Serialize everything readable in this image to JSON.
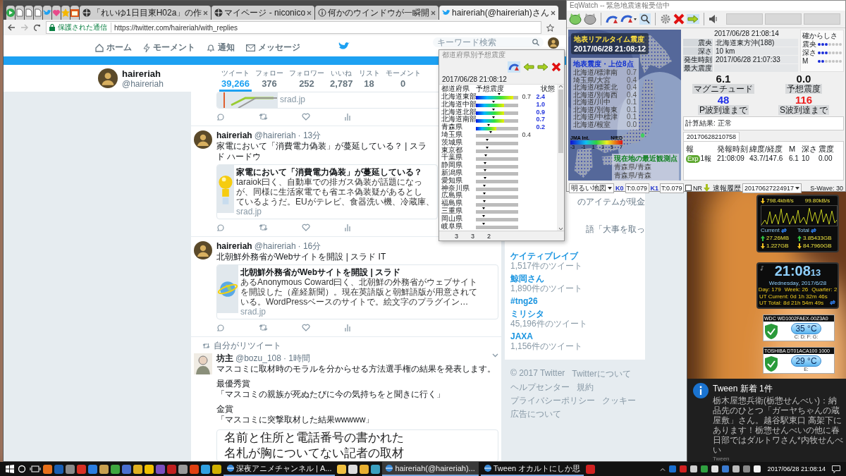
{
  "browser": {
    "pinned_tabs": [
      {
        "kind": "feed",
        "selected": false
      },
      {
        "kind": "page",
        "selected": false
      },
      {
        "kind": "page",
        "selected": false
      },
      {
        "kind": "page",
        "selected": false
      },
      {
        "kind": "bird",
        "selected": false
      },
      {
        "kind": "heart",
        "selected": false
      },
      {
        "kind": "star",
        "selected": false
      },
      {
        "kind": "calendar",
        "selected": false
      }
    ],
    "tabs": [
      {
        "kind": "globe",
        "title": "「れいゆ1日目東H02a」の作",
        "selected": false
      },
      {
        "kind": "globe",
        "title": "マイページ - niconico",
        "selected": false
      },
      {
        "kind": "info",
        "title": "何かのウインドウが一瞬開",
        "selected": false
      },
      {
        "kind": "bird",
        "title": "haireriah(@haireriah)さん",
        "selected": true
      }
    ],
    "secure_label": "保護された通信",
    "url": "https://twitter.com/haireriah/with_replies"
  },
  "twitter": {
    "nav": [
      {
        "kind": "home",
        "label": "ホーム",
        "selected": false
      },
      {
        "kind": "bolt",
        "label": "モーメント",
        "selected": false
      },
      {
        "kind": "bell",
        "label": "通知",
        "selected": false
      },
      {
        "kind": "mail",
        "label": "メッセージ",
        "selected": false
      }
    ],
    "search_placeholder": "キーワード検索",
    "profile": {
      "name": "haireriah",
      "handle": "@haireriah"
    },
    "stats": [
      {
        "label": "ツイート",
        "value": "39,266",
        "selected": true
      },
      {
        "label": "フォロー",
        "value": "376",
        "selected": false
      },
      {
        "label": "フォロワー",
        "value": "252",
        "selected": false
      },
      {
        "label": "いいね",
        "value": "2,787",
        "selected": false
      },
      {
        "label": "リスト",
        "value": "18",
        "selected": false
      },
      {
        "label": "モーメント",
        "value": "0",
        "selected": false
      }
    ],
    "tweets": [
      {
        "kind": "tail",
        "card": {
          "source": "srad.jp"
        }
      },
      {
        "kind": "link",
        "name": "haireriah",
        "handle": "@haireriah",
        "time": "· 13分",
        "text": "家電において「消費電力偽装」が蔓延している？ | スラド ハードウ",
        "card": {
          "title": "家電において「消費電力偽装」が蔓延している？",
          "lines": [
            "taraiok曰く、自動車での排ガス偽装が話題になっ",
            "が、同様に生活家電でも省エネ偽装疑があるとし",
            "ているようだ。EUがテレビ、食器洗い機、冷蔵庫、"
          ],
          "source": "srad.jp"
        }
      },
      {
        "kind": "link",
        "name": "haireriah",
        "handle": "@haireriah",
        "time": "· 16分",
        "text": "北朝鮮外務省がWebサイトを開設 | スラド IT",
        "card": {
          "title": "北朝鮮外務省がWebサイトを開設 | スラド",
          "lines": [
            "あるAnonymous Coward曰く、北朝鮮の外務省がウェブサイト",
            "を開設した（産経新聞）。現在英語版と朝鮮語版が用意されて",
            "いる。WordPressベースのサイトで。絵文字のプラグイン…"
          ],
          "source": "srad.jp"
        }
      },
      {
        "kind": "retweet",
        "retweeted_by": "自分がリツイート",
        "name": "坊主",
        "handle": "@bozu_108",
        "time": "· 1時間",
        "paragraphs": [
          [
            "マスコミに取材時のモラルを分からせる方法選手権の結果を発表します。"
          ],
          [
            "最優秀賞",
            "「マスコミの親族が死ぬたびに今の気持ちをと聞きに行く」"
          ],
          [
            "金賞",
            "「マスコミに突撃取材した結果wwwww」"
          ]
        ],
        "image_lines": [
          "名前と住所と電話番号の書かれた",
          "名札が胸についてない記者の取材"
        ]
      }
    ],
    "trend_fragments": [
      "のアイテムが現金",
      "語「大事を取っ"
    ],
    "trends": [
      {
        "name": "ケイティブレイブ",
        "count": "1,517件のツイート"
      },
      {
        "name": "鯨岡さん",
        "count": "1,890件のツイート"
      },
      {
        "name": "#tng26"
      },
      {
        "name": "ミリシタ",
        "count": "45,196件のツイート"
      },
      {
        "name": "JAXA",
        "count": "1,156件のツイート"
      }
    ],
    "footer": [
      "© 2017 Twitter",
      "Twitterについて",
      "ヘルプセンター",
      "規約",
      "プライバシーポリシー",
      "クッキー",
      "広告について"
    ]
  },
  "prefecture_popup": {
    "title": "都道府県別予想震度",
    "time": "2017/06/28 21:08:12",
    "columns": [
      "都道府県",
      "予想震度",
      "状態"
    ],
    "rows": [
      {
        "name": "北海道東部",
        "highlighted": true,
        "level": 0.55,
        "reading": "0.7",
        "status": "2.4"
      },
      {
        "name": "北海道中部",
        "highlighted": true,
        "level": 0.42,
        "status": "1.0"
      },
      {
        "name": "北海道北部",
        "highlighted": true,
        "level": 0.42,
        "status": "0.9"
      },
      {
        "name": "北海道南部",
        "highlighted": true,
        "level": 0.42,
        "status": "0.7"
      },
      {
        "name": "青森県",
        "highlighted": true,
        "level": 0.3,
        "status": "0.2"
      },
      {
        "name": "埼玉県",
        "highlighted": false,
        "level": 0.35,
        "reading": "0.4"
      },
      {
        "name": "茨城県",
        "highlighted": false,
        "level": 0.27
      },
      {
        "name": "東京都",
        "highlighted": false,
        "level": 0.26
      },
      {
        "name": "千葉県",
        "highlighted": false,
        "level": 0.23
      },
      {
        "name": "静岡県",
        "highlighted": false,
        "level": 0.22
      },
      {
        "name": "新潟県",
        "highlighted": false,
        "level": 0.22
      },
      {
        "name": "愛知県",
        "highlighted": false,
        "level": 0.21
      },
      {
        "name": "神奈川県",
        "highlighted": false,
        "level": 0.2
      },
      {
        "name": "広島県",
        "highlighted": false,
        "level": 0.2
      },
      {
        "name": "福島県",
        "highlighted": false,
        "level": 0.2
      },
      {
        "name": "三重県",
        "highlighted": false,
        "level": 0.19
      },
      {
        "name": "岡山県",
        "highlighted": false,
        "level": 0.19
      },
      {
        "name": "岐阜県",
        "highlighted": false,
        "level": 0.18
      }
    ],
    "footer": [
      "3",
      "3",
      "2"
    ]
  },
  "eqwatch": {
    "title": "EqWatch -- 緊急地震速報受信中",
    "overlay_title": "地表リアルタイム震度",
    "overlay_time": "2017/06/28 21:08:12",
    "top_title": "地表震度・上位8点",
    "top_points": [
      {
        "name": "北海道/標津南",
        "value": "0.7"
      },
      {
        "name": "埼玉県/大宮",
        "value": "0.4"
      },
      {
        "name": "北海道/標茶北",
        "value": "0.4"
      },
      {
        "name": "北海道/別海西",
        "value": "0.4"
      },
      {
        "name": "北海道/川中",
        "value": "0.1"
      },
      {
        "name": "北海道/別海東",
        "value": "0.1"
      },
      {
        "name": "北海道/中標津",
        "value": "0.1"
      },
      {
        "name": "北海道/根室",
        "value": "0.0"
      }
    ],
    "scale": {
      "label": "JMA Int.",
      "source": "NIED",
      "ticks": [
        "-3",
        "-1",
        "1",
        "3",
        "5",
        "7"
      ]
    },
    "nearest": {
      "title": "現在地の最近観測点",
      "points": [
        "青森県/青森",
        "青森県/青森"
      ]
    },
    "report_time": "2017/06/28 21:08:14",
    "fields": [
      {
        "label": "震央",
        "value": "北海道東方沖(188)"
      },
      {
        "label": "深さ",
        "value": "10 km"
      },
      {
        "label": "発生時刻",
        "value": "2017/06/28 21:07:33"
      },
      {
        "label": "最大震度"
      }
    ],
    "certainty": {
      "title": "確からしさ",
      "items": [
        {
          "label": "震央",
          "stars": 3
        },
        {
          "label": "深さ",
          "stars": 3
        },
        {
          "label": "M",
          "stars": 2
        }
      ]
    },
    "figures": [
      {
        "value": "6.1",
        "label": "マグニチュード",
        "color": "#111111"
      },
      {
        "value": "0.0",
        "label": "予想震度",
        "color": "#111111"
      },
      {
        "value": "48",
        "label": "P波到達まで",
        "color": "#1f2ee8"
      },
      {
        "value": "116",
        "label": "S波到達まで",
        "color": "#ee1c1c"
      }
    ],
    "result": "計算結果: 正常",
    "tab": "20170628210758",
    "table": {
      "columns": [
        "報",
        "発報時刻",
        "緯度/経度",
        "M",
        "深さ",
        "震度"
      ],
      "rows": [
        {
          "badge": "Exp",
          "cells": [
            "1報",
            "21:08:09",
            "43.7/147.6",
            "6.1",
            "10",
            "0.00"
          ]
        }
      ]
    },
    "map_style": "明るい地図",
    "k0_label": "K0",
    "k0": "T:0.079",
    "k1_label": "K1",
    "k1": "T:0.079",
    "nr": {
      "label": "NR",
      "checked": false
    },
    "history_label": "速報履歴",
    "history": "20170627224917",
    "swave": "S-Wave: 30"
  },
  "network": {
    "down": "798.4kbit/s",
    "down2": "99.80kB/s",
    "current_label": "Current",
    "total_label": "Total",
    "current_up": "27.26MB",
    "total_up": "3.85433GB",
    "current_down": "1.227GB",
    "total_down": "84.7960GB"
  },
  "clock": {
    "time": "21:08",
    "seconds": "13",
    "date": "Wednesday, 2017/6/28",
    "day": "Day: 179",
    "week": "Week: 26",
    "quarter": "Quarter: 2",
    "ut_current": "UT Current: 0d 1h 32m 46s",
    "ut_total": "UT Total: 8d 21h 54m 49s"
  },
  "disks": [
    {
      "model": "WDC WD1002FAEX-00Z3A0",
      "temp": "35 °C",
      "drives": "C: D: F: G:"
    },
    {
      "model": "TOSHIBA DT01ACA100 1000",
      "temp": "29 °C",
      "drives": "E:"
    }
  ],
  "notification": {
    "title": "Tween 新着 1件",
    "body": "栃木屋惣兵衛(栃惣せんべい)：納品先のひとつ「ガーヤちゃんの蔵屋敷」さん。越谷駅東口 高架下にあります！栃惣せんべいの他に春日部ではダルトワさん*内牧せんべい",
    "app": "Tween"
  },
  "taskbar": {
    "items": [
      {
        "kind": "start"
      },
      {
        "kind": "search"
      },
      {
        "kind": "taskview"
      },
      {
        "kind": "app",
        "color": "#e8701a"
      },
      {
        "kind": "app",
        "color": "#1a5fb4"
      },
      {
        "kind": "app",
        "color": "#8a8a8a"
      },
      {
        "kind": "app",
        "color": "#d93025"
      },
      {
        "kind": "app",
        "color": "#2a7de1"
      },
      {
        "kind": "app",
        "color": "#c8a050"
      },
      {
        "kind": "app",
        "color": "#3fa63f"
      },
      {
        "kind": "app",
        "color": "#4a6fd0"
      },
      {
        "kind": "app",
        "color": "#e0b020"
      },
      {
        "kind": "app",
        "color": "#f0c000"
      },
      {
        "kind": "app",
        "color": "#7a4fc0"
      },
      {
        "kind": "app",
        "color": "#c02020"
      },
      {
        "kind": "app",
        "color": "#9a9a9a"
      },
      {
        "kind": "app",
        "color": "#e04010"
      },
      {
        "kind": "app",
        "color": "#30a0e0"
      },
      {
        "kind": "app",
        "color": "#d0b000"
      },
      {
        "kind": "window",
        "title": "深夜アニメチャンネル | A...",
        "selected": false
      },
      {
        "kind": "app",
        "color": "#f0c040"
      },
      {
        "kind": "app",
        "color": "#dddddd"
      },
      {
        "kind": "app",
        "color": "#e8b030"
      },
      {
        "kind": "app",
        "color": "#3aa0c0"
      },
      {
        "kind": "window",
        "title": "haireriah(@haireriah)...",
        "selected": true
      },
      {
        "kind": "window",
        "title": "Tween オカルトにしか思",
        "selected": false
      },
      {
        "kind": "app",
        "color": "#d02020"
      }
    ],
    "tray": [
      {
        "color": "#1a6fd0"
      },
      {
        "color": "#d02020"
      },
      {
        "color": "#cfcfcf"
      },
      {
        "color": "#30a040"
      },
      {
        "color": "#e0e0e0"
      },
      {
        "color": "#3a7ad0"
      },
      {
        "color": "#bbbbbb"
      },
      {
        "color": "#888888"
      },
      {
        "color": "#f2f2f2"
      }
    ],
    "clock": "2017/06/28 21:08:14"
  }
}
